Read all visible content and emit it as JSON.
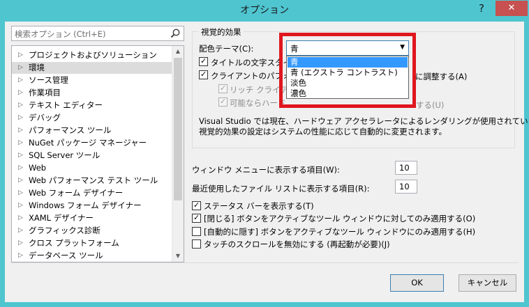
{
  "window": {
    "title": "オプション",
    "help": "?",
    "close": "✕"
  },
  "search": {
    "placeholder": "検索オプション (Ctrl+E)"
  },
  "tree": {
    "items": [
      {
        "label": "プロジェクトおよびソリューション",
        "selected": false
      },
      {
        "label": "環境",
        "selected": true
      },
      {
        "label": "ソース管理",
        "selected": false
      },
      {
        "label": "作業項目",
        "selected": false
      },
      {
        "label": "テキスト エディター",
        "selected": false
      },
      {
        "label": "デバッグ",
        "selected": false
      },
      {
        "label": "パフォーマンス ツール",
        "selected": false
      },
      {
        "label": "NuGet パッケージ マネージャー",
        "selected": false
      },
      {
        "label": "SQL Server ツール",
        "selected": false
      },
      {
        "label": "Web",
        "selected": false
      },
      {
        "label": "Web パフォーマンス テスト ツール",
        "selected": false
      },
      {
        "label": "Web フォーム デザイナー",
        "selected": false
      },
      {
        "label": "Windows フォーム デザイナー",
        "selected": false
      },
      {
        "label": "XAML デザイナー",
        "selected": false
      },
      {
        "label": "グラフィックス診断",
        "selected": false
      },
      {
        "label": "クロス プラットフォーム",
        "selected": false
      },
      {
        "label": "データベース ツール",
        "selected": false
      }
    ]
  },
  "visual": {
    "group_label": "視覚的効果",
    "theme_label": "配色テーマ(C):",
    "theme_value": "青",
    "theme_options": [
      "青",
      "青 (エクストラ コントラスト)",
      "淡色",
      "濃色"
    ],
    "chk_text_style": "タイトルの文字スタイル",
    "chk_client": "クライアントのパフォーマンスに基づいて視覚的効果を自動的に調整する(A)",
    "chk_client_visible_start": "クライアントのパフォー",
    "chk_client_visible_end": "に調整する(A)",
    "chk_rich": "リッチ クライアントの",
    "chk_rich_visible": "リッチ クライアント",
    "chk_hw": "可能ならハードウェアのグラフィックス アクセラレータを使用する(U)",
    "chk_hw_visible_start": "可能ならハード",
    "chk_hw_visible_end": "する(U)",
    "info_line1": "Visual Studio では現在、ハードウェア アクセラレータによるレンダリングが使用されています。",
    "info_line2": "視覚的効果の設定はシステムの性能に応じて自動的に変更されます。"
  },
  "settings": {
    "window_menu_label": "ウィンドウ メニューに表示する項目(W):",
    "window_menu_value": "10",
    "recent_files_label": "最近使用したファイル リストに表示する項目(R):",
    "recent_files_value": "10",
    "chk_status_bar": "ステータス バーを表示する(T)",
    "chk_close_button": "[閉じる] ボタンをアクティブなツール ウィンドウに対してのみ適用する(O)",
    "chk_autohide_button": "[自動的に隠す] ボタンをアクティブなツール ウィンドウにのみ適用する(H)",
    "chk_touch_scroll": "タッチのスクロールを無効にする (再起動が必要)(J)"
  },
  "buttons": {
    "ok": "OK",
    "cancel": "キャンセル"
  },
  "colors": {
    "titlebar": "#4fc5d0",
    "close": "#c75050",
    "highlight": "#3399ff",
    "annotation": "#e0161e"
  },
  "icons": {
    "search": "search-icon",
    "expand": "expand-arrow-icon",
    "dropdown": "chevron-down-icon"
  }
}
